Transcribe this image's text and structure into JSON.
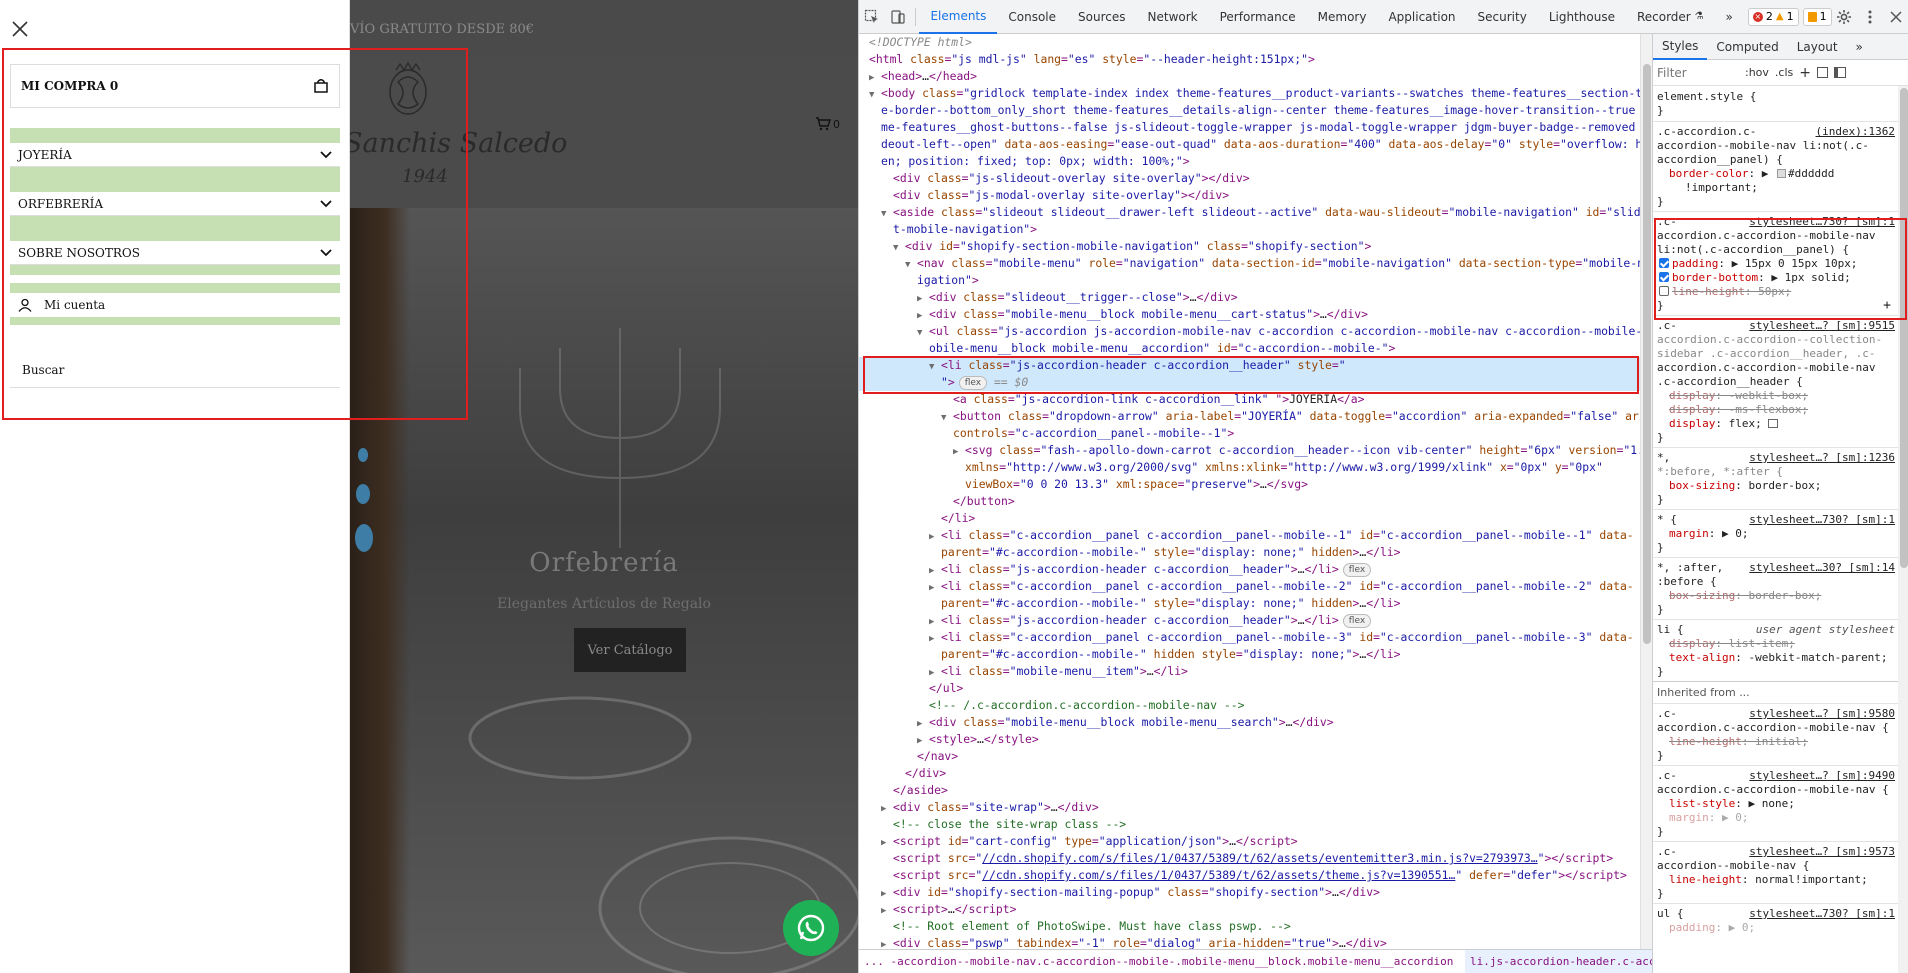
{
  "site": {
    "promo_text": "VÍO GRATUITO DESDE 80€",
    "logo_name": "Sanchis Salcedo",
    "logo_year": "1944",
    "cart_count": "0",
    "hero_title": "Orfebrería",
    "hero_subtitle": "Elegantes Artículos de Regalo",
    "hero_button": "Ver Catálogo"
  },
  "drawer": {
    "cart_label": "MI COMPRA 0",
    "accordion": [
      {
        "label": "JOYERÍA"
      },
      {
        "label": "ORFEBRERÍA"
      },
      {
        "label": "SOBRE NOSOTROS"
      }
    ],
    "account_label": "Mi cuenta",
    "search_label": "Buscar"
  },
  "devtools": {
    "tabs": [
      "Elements",
      "Console",
      "Sources",
      "Network",
      "Performance",
      "Memory",
      "Application",
      "Security",
      "Lighthouse",
      "Recorder"
    ],
    "active_tab": "Elements",
    "more_tabs": "»",
    "errors": "2",
    "warnings": "1",
    "issues": "1",
    "style_tabs": [
      "Styles",
      "Computed",
      "Layout",
      "»"
    ],
    "filter_placeholder": "Filter",
    "hov": ":hov",
    "cls": ".cls",
    "inherited_label": "Inherited from ...",
    "breadcrumb_1": "... -accordion--mobile-nav.c-accordion--mobile-.mobile-menu__block.mobile-menu__accordion",
    "breadcrumb_2": "li.js-accordion-header.c-accordion__header"
  },
  "colors": {
    "highlight": "#e01e1e",
    "accordion_padding": "#c6e0b4",
    "devtools_accent": "#1a73e8",
    "whatsapp": "#1fb155"
  }
}
